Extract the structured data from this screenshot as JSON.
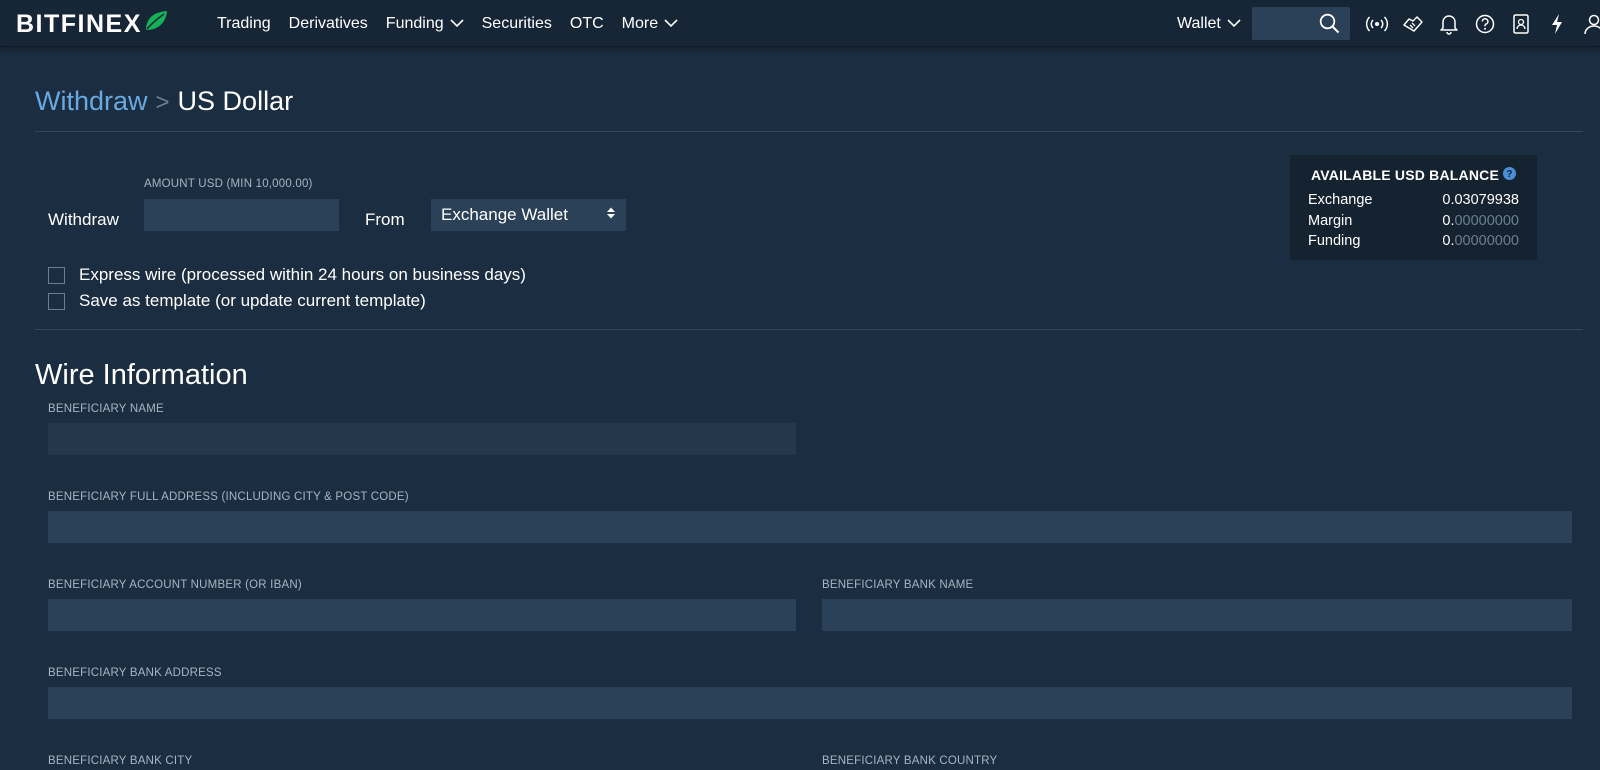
{
  "brand": {
    "logo_text": "BITFINEX"
  },
  "nav": {
    "items": [
      {
        "label": "Trading",
        "has_dropdown": false
      },
      {
        "label": "Derivatives",
        "has_dropdown": false
      },
      {
        "label": "Funding",
        "has_dropdown": true
      },
      {
        "label": "Securities",
        "has_dropdown": false
      },
      {
        "label": "OTC",
        "has_dropdown": false
      },
      {
        "label": "More",
        "has_dropdown": true
      }
    ],
    "wallet_label": "Wallet",
    "search_placeholder": "",
    "tool_icons": [
      "broadcast-icon",
      "handshake-icon",
      "bell-icon",
      "help-icon",
      "address-book-icon",
      "lightning-icon",
      "user-icon"
    ]
  },
  "breadcrumb": {
    "parent": "Withdraw",
    "separator": ">",
    "current": "US Dollar"
  },
  "withdraw_form": {
    "withdraw_label": "Withdraw",
    "amount_label": "AMOUNT USD (MIN 10,000.00)",
    "amount_value": "",
    "from_label": "From",
    "from_selected": "Exchange Wallet",
    "express_wire_label": "Express wire (processed within 24 hours on business days)",
    "express_wire_checked": false,
    "save_template_label": "Save as template (or update current template)",
    "save_template_checked": false
  },
  "balance": {
    "title": "AVAILABLE USD BALANCE",
    "rows": [
      {
        "name": "Exchange",
        "int": "0.",
        "frac": "03079938",
        "frac_dim": false
      },
      {
        "name": "Margin",
        "int": "0.",
        "frac": "00000000",
        "frac_dim": true
      },
      {
        "name": "Funding",
        "int": "0.",
        "frac": "00000000",
        "frac_dim": true
      }
    ]
  },
  "wire": {
    "title": "Wire Information",
    "fields": {
      "beneficiary_name": {
        "label": "BENEFICIARY NAME",
        "value": ""
      },
      "beneficiary_address": {
        "label": "BENEFICIARY FULL ADDRESS (INCLUDING CITY & POST CODE)",
        "value": ""
      },
      "account_number": {
        "label": "BENEFICIARY ACCOUNT NUMBER (OR IBAN)",
        "value": ""
      },
      "bank_name": {
        "label": "BENEFICIARY BANK NAME",
        "value": ""
      },
      "bank_address": {
        "label": "BENEFICIARY BANK ADDRESS",
        "value": ""
      },
      "bank_city": {
        "label": "BENEFICIARY BANK CITY",
        "value": ""
      },
      "bank_country": {
        "label": "BENEFICIARY BANK COUNTRY",
        "value": ""
      }
    }
  },
  "colors": {
    "background": "#1b2d40",
    "topbar": "#172637",
    "input": "#2b4158",
    "link": "#6aa8e0",
    "brand_leaf": "#16b157"
  }
}
